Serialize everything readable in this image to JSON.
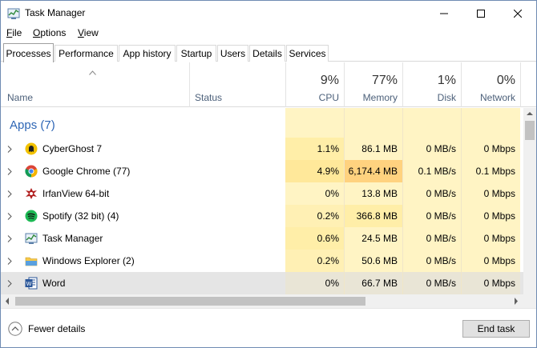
{
  "window": {
    "title": "Task Manager",
    "buttons": [
      "minimize",
      "maximize",
      "close"
    ]
  },
  "menu": [
    {
      "label": "File",
      "accel": "F",
      "rest": "ile"
    },
    {
      "label": "Options",
      "accel": "O",
      "rest": "ptions"
    },
    {
      "label": "View",
      "accel": "V",
      "rest": "iew"
    }
  ],
  "tabs": [
    "Processes",
    "Performance",
    "App history",
    "Startup",
    "Users",
    "Details",
    "Services"
  ],
  "active_tab": "Processes",
  "columns": {
    "name": "Name",
    "status": "Status",
    "cpu": {
      "pct": "9%",
      "label": "CPU"
    },
    "memory": {
      "pct": "77%",
      "label": "Memory"
    },
    "disk": {
      "pct": "1%",
      "label": "Disk"
    },
    "network": {
      "pct": "0%",
      "label": "Network"
    }
  },
  "group": {
    "title": "Apps (7)"
  },
  "rows": [
    {
      "name": "CyberGhost 7",
      "icon": "cyberghost-icon",
      "cpu": "1.1%",
      "memory": "86.1 MB",
      "disk": "0 MB/s",
      "network": "0 Mbps"
    },
    {
      "name": "Google Chrome (77)",
      "icon": "chrome-icon",
      "cpu": "4.9%",
      "memory": "6,174.4 MB",
      "disk": "0.1 MB/s",
      "network": "0.1 Mbps"
    },
    {
      "name": "IrfanView 64-bit",
      "icon": "irfanview-icon",
      "cpu": "0%",
      "memory": "13.8 MB",
      "disk": "0 MB/s",
      "network": "0 Mbps"
    },
    {
      "name": "Spotify (32 bit) (4)",
      "icon": "spotify-icon",
      "cpu": "0.2%",
      "memory": "366.8 MB",
      "disk": "0 MB/s",
      "network": "0 Mbps"
    },
    {
      "name": "Task Manager",
      "icon": "task-manager-icon",
      "cpu": "0.6%",
      "memory": "24.5 MB",
      "disk": "0 MB/s",
      "network": "0 Mbps"
    },
    {
      "name": "Windows Explorer (2)",
      "icon": "folder-icon",
      "cpu": "0.2%",
      "memory": "50.6 MB",
      "disk": "0 MB/s",
      "network": "0 Mbps"
    },
    {
      "name": "Word",
      "icon": "word-icon",
      "cpu": "0%",
      "memory": "66.7 MB",
      "disk": "0 MB/s",
      "network": "0 Mbps"
    }
  ],
  "footer": {
    "fewer_details": "Fewer details",
    "end_task": "End task"
  },
  "colors": {
    "heat_light": "#fff4c4",
    "heat_mid": "#ffe89a",
    "heat_strong": "#ffd27f",
    "group_blue": "#2e66b5",
    "selected_row": "#e5e5e5"
  }
}
